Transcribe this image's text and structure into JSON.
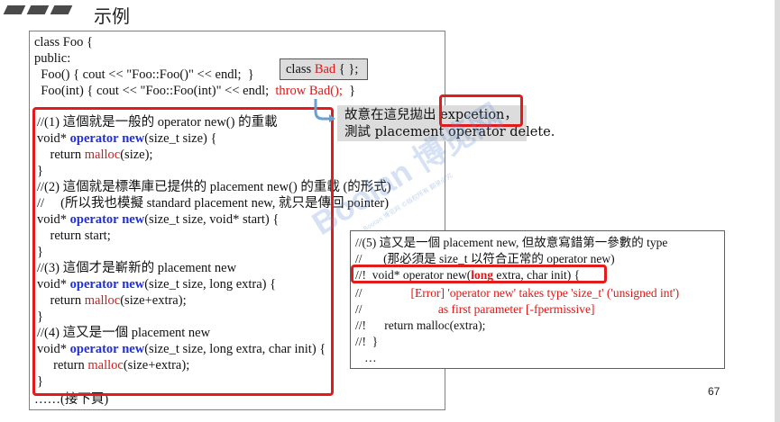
{
  "header": {
    "title": "示例"
  },
  "main_code": {
    "class_line": "class Foo {",
    "public_line": "public:",
    "ctor1": "  Foo() { cout << \"Foo::Foo()\" << endl;  }",
    "ctor2_pre": "  Foo(int) { cout << \"Foo::Foo(int)\" << endl;  ",
    "ctor2_throw": "throw Bad();",
    "ctor2_post": "  }",
    "c1_comment": "//(1) 這個就是一般的 operator new() 的重載",
    "c1_sig_pre": "void* ",
    "c1_kw_operator": "operator",
    "c1_kw_new": "new",
    "c1_sig_post": "(size_t size) {",
    "c1_ret_pre": "    return ",
    "c1_ret_fn": "malloc",
    "c1_ret_post": "(size);",
    "c1_close": "}",
    "c2_comment": "//(2) 這個就是標準庫已提供的 placement new() 的重載 (的形式)",
    "c2_comment2": "//     (所以我也模擬 standard placement new, 就只是傳回 pointer)",
    "c2_sig_pre": "void* ",
    "c2_kw_operator": "operator",
    "c2_kw_new": "new",
    "c2_sig_post": "(size_t size, void* start) {",
    "c2_ret": "    return start;",
    "c2_close": "}",
    "c3_comment": "//(3) 這個才是嶄新的 placement new",
    "c3_sig_pre": "void* ",
    "c3_kw_operator": "operator",
    "c3_kw_new": "new",
    "c3_sig_post": "(size_t size, long extra) {",
    "c3_ret_pre": "    return ",
    "c3_ret_fn": "malloc",
    "c3_ret_post": "(size+extra);",
    "c3_close": "}",
    "c4_comment": "//(4) 這又是一個 placement new",
    "c4_sig_pre": "void* ",
    "c4_kw_operator": "operator",
    "c4_kw_new": "new",
    "c4_sig_post": "(size_t size, long extra, char init) {",
    "c4_ret_pre": "     return ",
    "c4_ret_fn": "malloc",
    "c4_ret_post": "(size+extra);",
    "c4_close": "}",
    "footer": "……(接下頁)"
  },
  "class_bad": {
    "pre": "class ",
    "name": "Bad",
    "post": " { };"
  },
  "note": {
    "line1_pre": "故意在這兒拋出 ",
    "line1_hl": "expcetion",
    "line1_post": "，",
    "line2": "測試 placement operator delete."
  },
  "box2": {
    "l1": "//(5) 這又是一個 placement new, 但故意寫錯第一參數的 type",
    "l2": "//       (那必須是 size_t 以符合正常的 operator new)",
    "l3_pre": "//!  void* operator new(",
    "l3_long": "long",
    "l3_post": " extra, char init) {",
    "l4": "//                ",
    "l4_err": "[Error] 'operator new' takes type 'size_t' ('unsigned int')",
    "l5": "//                         ",
    "l5_err": "as first parameter [-fpermissive]",
    "l6": "//!      return malloc(extra);",
    "l7": "//!  }",
    "l8": "   …"
  },
  "page_number": "67",
  "watermark": {
    "main": "Boolan 博览网",
    "sub": "Boolan 博览网 ©版权所有 翻录必究"
  },
  "colors": {
    "keyword": "#1f2fd6",
    "highlight": "#e01515",
    "frame": "#e31b1b",
    "note_bg": "#dcdcdc"
  }
}
